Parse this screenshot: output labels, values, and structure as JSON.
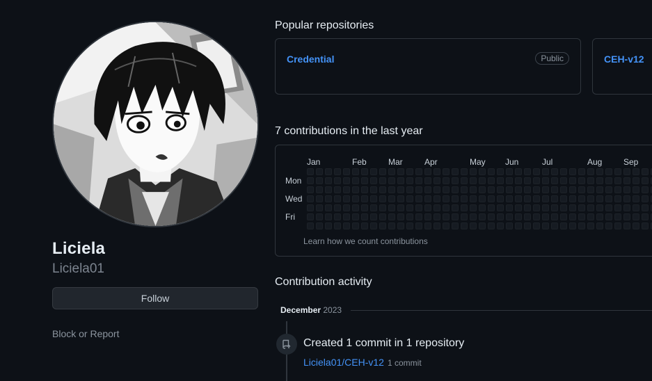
{
  "profile": {
    "display_name": "Liciela",
    "login": "Liciela01",
    "follow_label": "Follow",
    "block_label": "Block or Report"
  },
  "popular": {
    "title": "Popular repositories",
    "repos": [
      {
        "name": "Credential",
        "visibility": "Public"
      },
      {
        "name": "CEH-v12"
      }
    ]
  },
  "contributions": {
    "title": "7 contributions in the last year",
    "months": [
      "Jan",
      "Feb",
      "Mar",
      "Apr",
      "May",
      "Jun",
      "Jul",
      "Aug",
      "Sep"
    ],
    "days": [
      "Mon",
      "Wed",
      "Fri"
    ],
    "learn_label": "Learn how we count contributions"
  },
  "activity": {
    "title": "Contribution activity",
    "month": "December",
    "year": "2023",
    "item_title": "Created 1 commit in 1 repository",
    "item_repo": "Liciela01/CEH-v12",
    "item_count": "1 commit"
  },
  "colors": {
    "background": "#0d1117",
    "border": "#30363d",
    "link": "#4493f8",
    "muted": "#8b949e",
    "empty_cell": "#161b22"
  }
}
